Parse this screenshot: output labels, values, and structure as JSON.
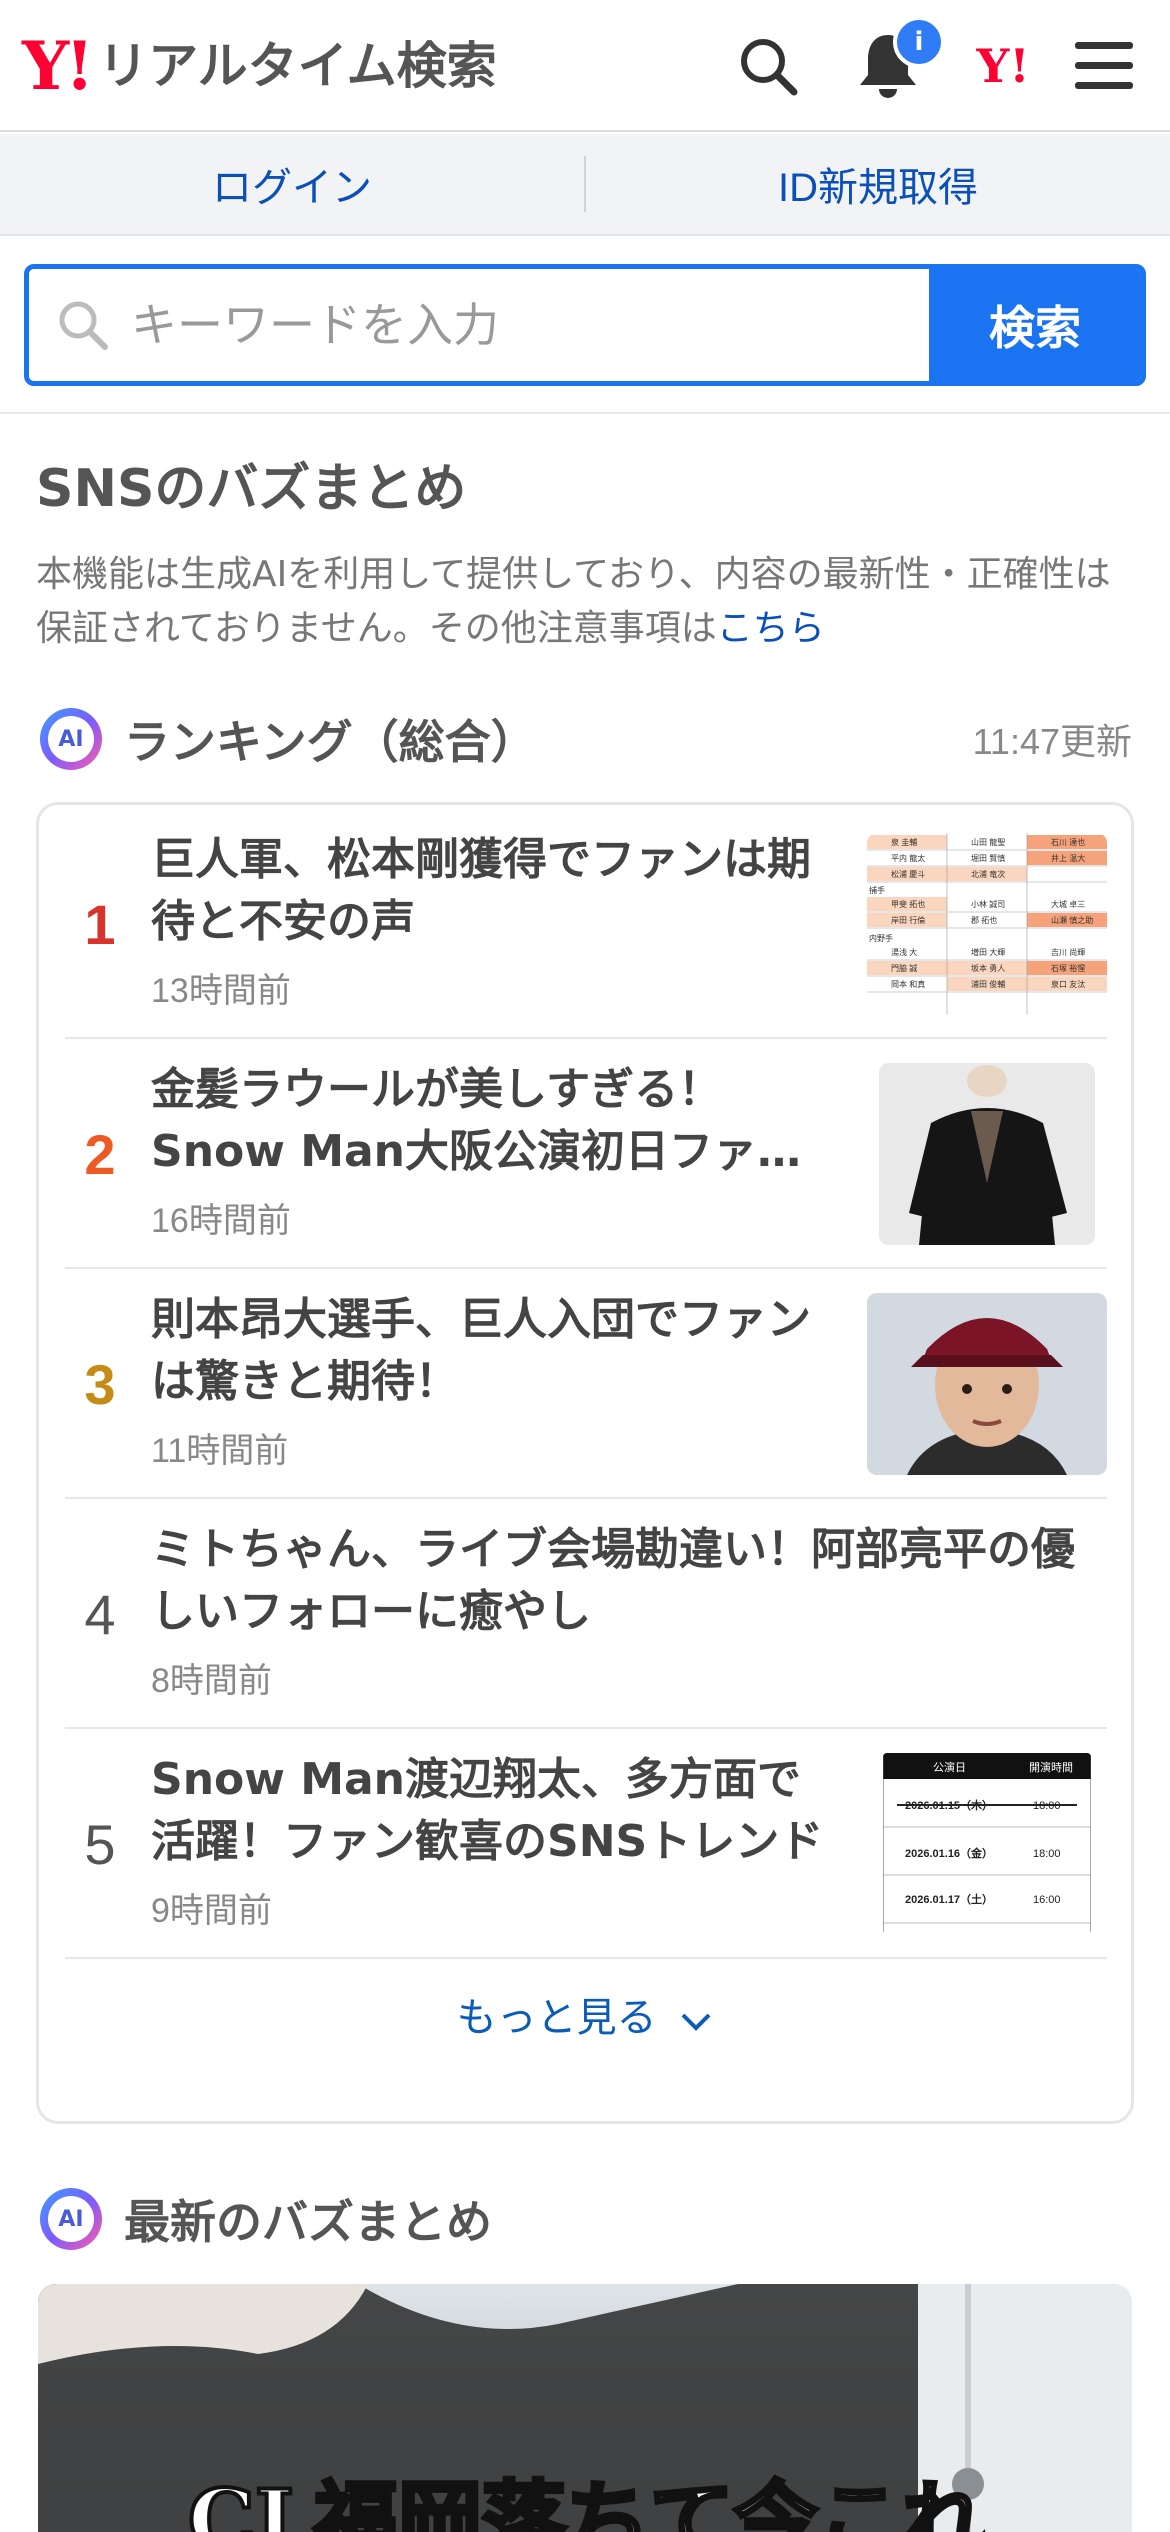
{
  "header": {
    "logo_mark": "Y!",
    "logo_text": "リアルタイム検索",
    "bell_badge": "i",
    "yj_mark": "Y!"
  },
  "loginbar": {
    "login": "ログイン",
    "register": "ID新規取得"
  },
  "search": {
    "placeholder": "キーワードを入力",
    "value": "",
    "button": "検索"
  },
  "sns": {
    "title": "SNSのバズまとめ",
    "notice": "本機能は生成AIを利用して提供しており、内容の最新性・正確性は保証されておりません。その他注意事項は",
    "notice_link": "こちら"
  },
  "ranking": {
    "ai_label": "AI",
    "title": "ランキング（総合）",
    "updated": "11:47更新",
    "items": [
      {
        "rank": "1",
        "title_line1": "巨人軍、松本剛獲得でファンは期",
        "title_line2": "待と不安の声",
        "time": "13時間前"
      },
      {
        "rank": "2",
        "title_line1": "金髪ラウールが美しすぎる！",
        "title_line2": "Snow Man大阪公演初日ファ…",
        "time": "16時間前"
      },
      {
        "rank": "3",
        "title_line1": "則本昂大選手、巨人入団でファン",
        "title_line2": "は驚きと期待！",
        "time": "11時間前"
      },
      {
        "rank": "4",
        "title_line1": "ミトちゃん、ライブ会場勘違い！阿部亮平の優",
        "title_line2": "しいフォローに癒やし",
        "time": "8時間前"
      },
      {
        "rank": "5",
        "title_line1": "Snow Man渡辺翔太、多方面で",
        "title_line2": "活躍！ファン歓喜のSNSトレンド",
        "time": "9時間前"
      }
    ],
    "more": "もっと見る"
  },
  "thumb1": {
    "rows": [
      [
        "泉 圭輔",
        "山田 龍聖",
        "石川 達也"
      ],
      [
        "平内 龍太",
        "堀田 賢慎",
        "井上 温大"
      ],
      [
        "松浦 慶斗",
        "北浦 竜次",
        ""
      ],
      [
        "甲斐 拓也",
        "小林 誠司",
        "大城 卓三"
      ],
      [
        "岸田 行倫",
        "郡 拓也",
        "山瀬 慎之助"
      ],
      [
        "湯浅 大",
        "増田 大輝",
        "吉川 尚輝"
      ],
      [
        "門脇 誠",
        "坂本 勇人",
        "石塚 裕惺"
      ],
      [
        "岡本 和真",
        "浦田 俊輔",
        "泉口 友汰"
      ]
    ],
    "label_catcher": "捕手",
    "label_infield": "内野手"
  },
  "thumb5": {
    "head_date": "公演日",
    "head_time": "開演時間",
    "rows": [
      {
        "date": "2026.01.15（木）",
        "time": "18:00"
      },
      {
        "date": "2026.01.16（金）",
        "time": "18:00"
      },
      {
        "date": "2026.01.17（土）",
        "time": "16:00"
      }
    ]
  },
  "latest": {
    "ai_label": "AI",
    "title": "最新のバズまとめ",
    "caption": "CL福岡落ちて今これ"
  },
  "colors": {
    "accent": "#1a73f0",
    "brand": "#ff0033",
    "rank1": "#d9342b",
    "rank2": "#ee5a24",
    "rank3": "#c48b15"
  }
}
